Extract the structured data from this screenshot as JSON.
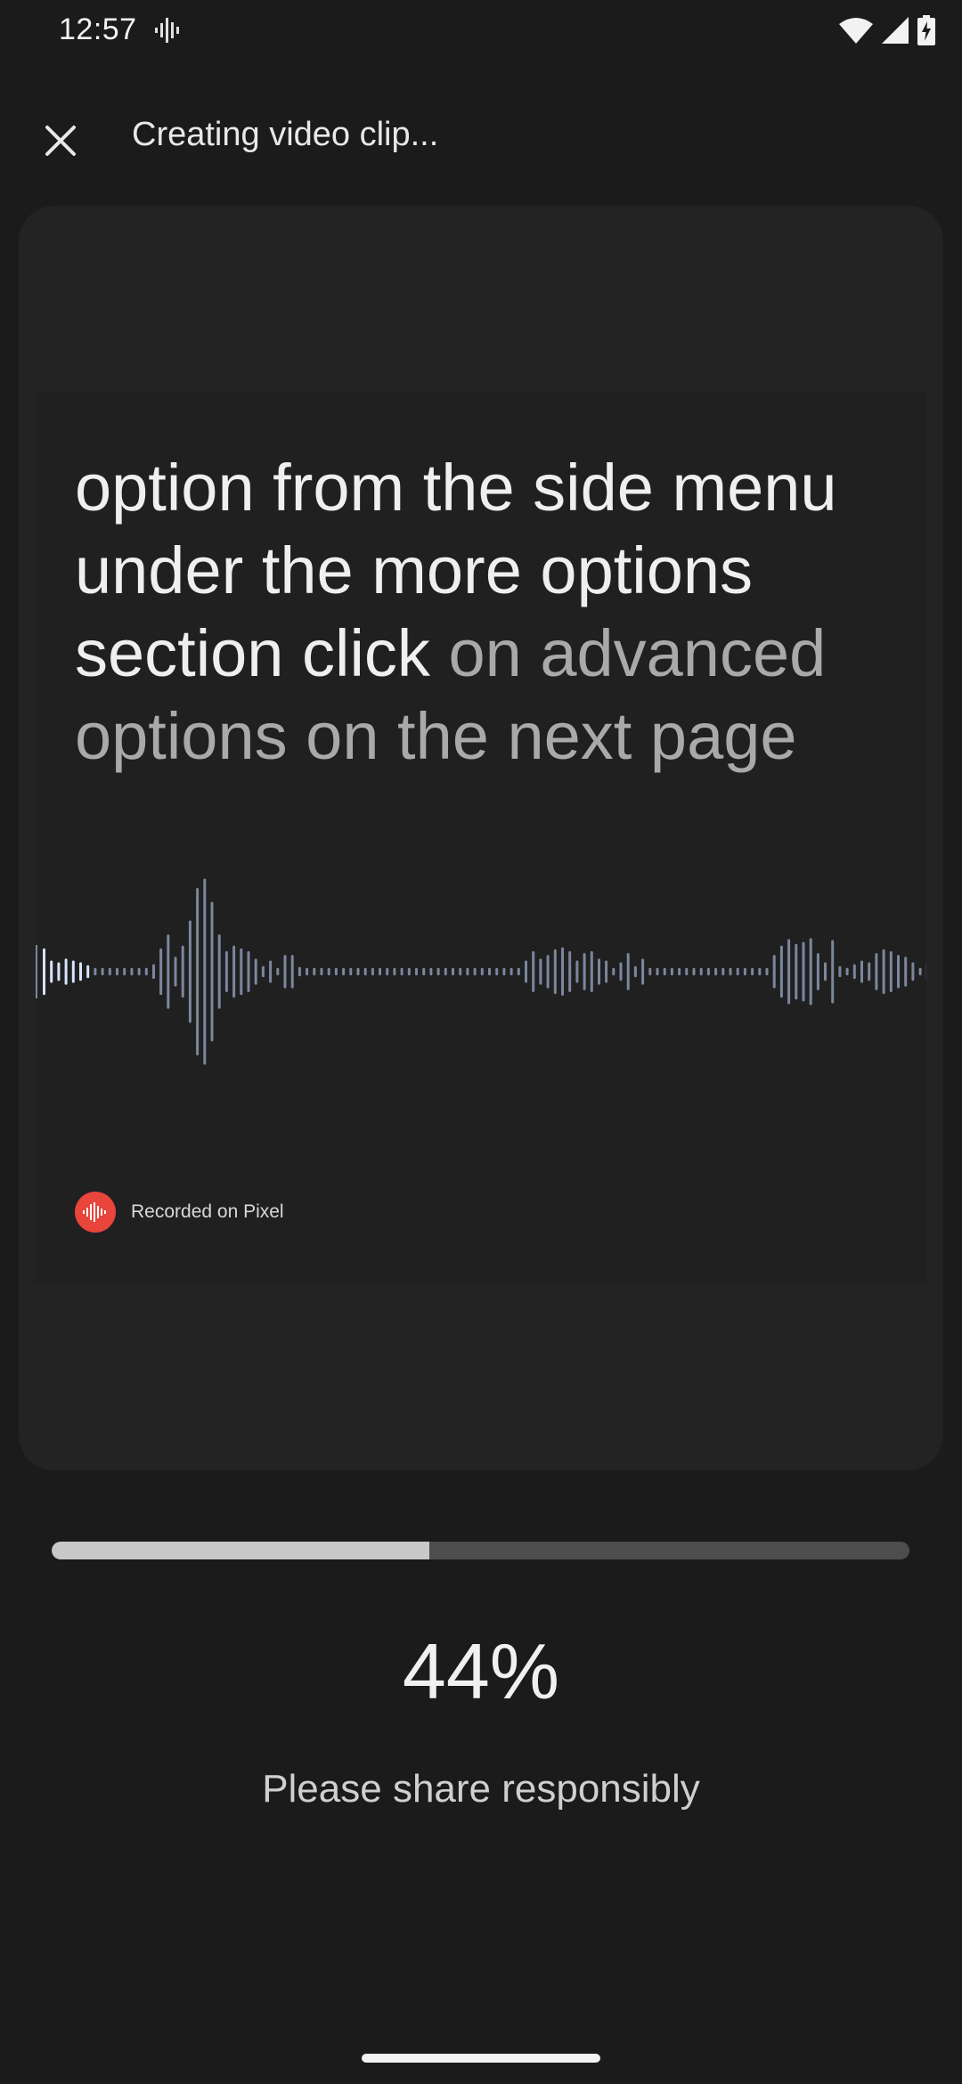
{
  "status_bar": {
    "time": "12:57",
    "icons": [
      "recorder-waveform-icon",
      "wifi-icon",
      "cell-signal-icon",
      "battery-charging-icon"
    ]
  },
  "top_bar": {
    "close_icon": "close-icon",
    "title": "Creating video clip..."
  },
  "clip": {
    "transcript_spoken": "option from the side menu under the more options section click ",
    "transcript_upcoming": "on advanced options on the next page",
    "brand_label": "Recorded on Pixel",
    "brand_icon": "recorder-logo-icon",
    "colors": {
      "played_wave": "#d6e4ff",
      "unplayed_wave": "#7b879e",
      "brand": "#e8453c"
    },
    "waveform_levels": [
      0.25,
      0.12,
      0.1,
      0.14,
      0.12,
      0.1,
      0.07,
      0.04,
      0.04,
      0.04,
      0.04,
      0.04,
      0.04,
      0.04,
      0.04,
      0.08,
      0.25,
      0.4,
      0.16,
      0.28,
      0.55,
      0.9,
      1.0,
      0.75,
      0.4,
      0.22,
      0.28,
      0.25,
      0.22,
      0.14,
      0.06,
      0.12,
      0.04,
      0.18,
      0.18,
      0.05,
      0.04,
      0.04,
      0.04,
      0.04,
      0.04,
      0.04,
      0.04,
      0.04,
      0.04,
      0.04,
      0.04,
      0.04,
      0.04,
      0.04,
      0.04,
      0.04,
      0.04,
      0.04,
      0.04,
      0.04,
      0.04,
      0.04,
      0.04,
      0.04,
      0.04,
      0.04,
      0.04,
      0.04,
      0.04,
      0.04,
      0.12,
      0.22,
      0.14,
      0.18,
      0.24,
      0.26,
      0.22,
      0.12,
      0.2,
      0.22,
      0.14,
      0.12,
      0.04,
      0.1,
      0.2,
      0.06,
      0.14,
      0.04,
      0.04,
      0.04,
      0.04,
      0.04,
      0.04,
      0.04,
      0.04,
      0.04,
      0.04,
      0.04,
      0.04,
      0.04,
      0.04,
      0.04,
      0.04,
      0.04,
      0.18,
      0.28,
      0.35,
      0.3,
      0.32,
      0.36,
      0.2,
      0.1,
      0.34,
      0.06,
      0.04,
      0.08,
      0.12,
      0.1,
      0.2,
      0.24,
      0.22,
      0.18,
      0.16,
      0.1,
      0.04,
      0.1
    ],
    "played_fraction": 0.06
  },
  "progress": {
    "value": 0.44,
    "percent_label": "44%"
  },
  "footer": {
    "share_note": "Please share responsibly"
  }
}
